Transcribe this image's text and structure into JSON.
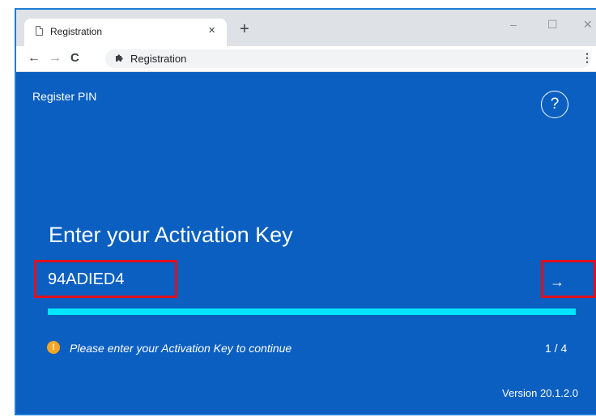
{
  "browser": {
    "tab_title": "Registration",
    "tab_close": "×",
    "new_tab": "+",
    "window_minimize": "–",
    "window_maximize": "☐",
    "window_close": "✕",
    "nav_back": "←",
    "nav_forward": "→",
    "nav_reload": "C",
    "address": "Registration",
    "menu": "⋮"
  },
  "app": {
    "title": "Register PIN",
    "help": "?",
    "heading": "Enter your Activation Key",
    "activation_key": "94ADIED4",
    "next_arrow": "→",
    "progress_fraction": 1.0,
    "warning_glyph": "!",
    "message": "Please enter your Activation Key to continue",
    "step": "1  /  4",
    "version": "Version 20.1.2.0",
    "colors": {
      "background": "#0a5fc1",
      "progress": "#00e5ff",
      "warning": "#f5a623",
      "highlight": "#e0101a"
    }
  }
}
